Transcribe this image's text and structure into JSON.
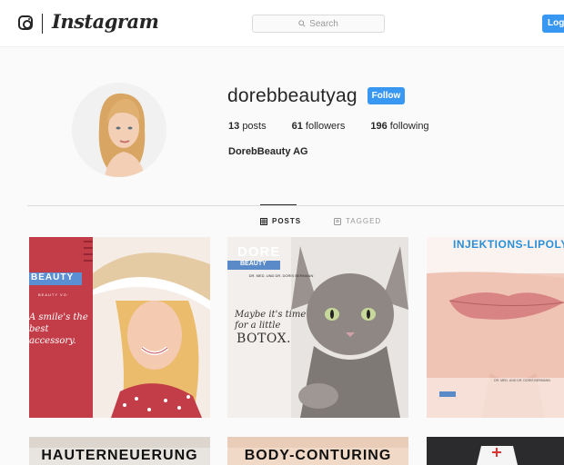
{
  "header": {
    "wordmark": "Instagram",
    "search_placeholder": "Search",
    "login_label": "Log",
    "accent_color": "#3897f0"
  },
  "profile": {
    "username": "dorebbeautyag",
    "follow_label": "Follow",
    "stats": {
      "posts_count": "13",
      "posts_label": "posts",
      "followers_count": "61",
      "followers_label": "followers",
      "following_count": "196",
      "following_label": "following"
    },
    "full_name": "DorebBeauty AG"
  },
  "tabs": {
    "posts": "POSTS",
    "tagged": "TAGGED"
  },
  "posts": [
    {
      "beauty_tag": "BEAUTY",
      "beauty_small": "BEAUTY VO·",
      "headline": "A smile's the best accessory."
    },
    {
      "brand_top": "DORE",
      "brand_bar": "BEAUTY",
      "doctor": "DR. MED. UND DR. DORIS BERMANN",
      "headline": "Maybe it's time for a little",
      "product": "BOTOX."
    },
    {
      "headline": "INJEKTIONS-LIPOLY",
      "footer": "DR. MED. UND DR. DORIS BERMANN"
    },
    {
      "headline": "HAUTERNEUERUNG"
    },
    {
      "headline": "BODY-CONTURING"
    },
    {
      "headline": ""
    }
  ]
}
